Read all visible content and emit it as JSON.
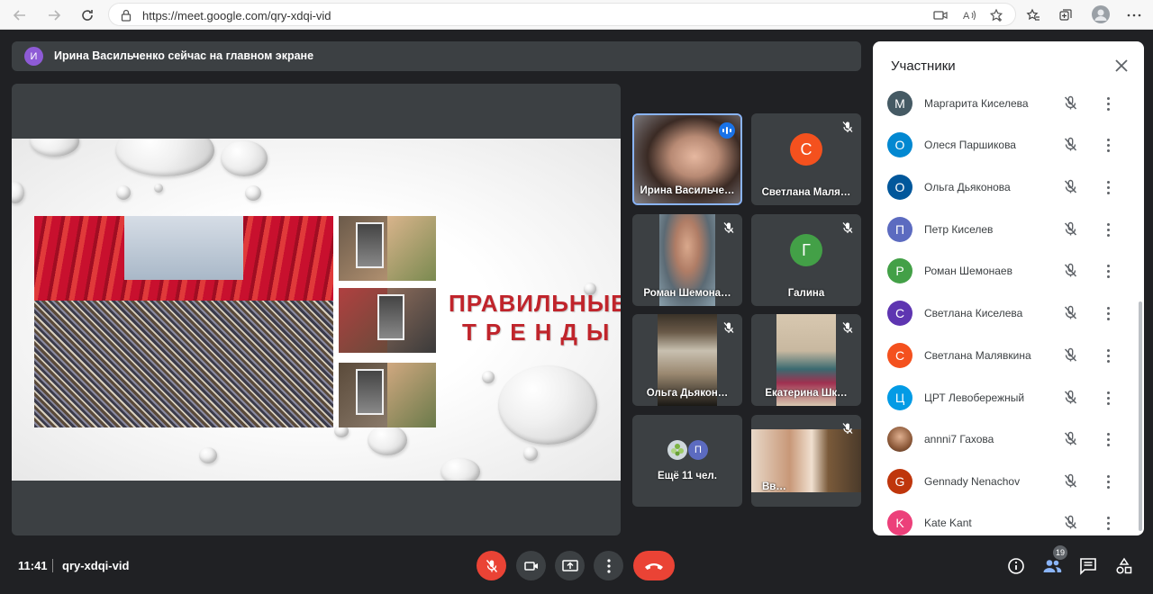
{
  "browser": {
    "url": "https://meet.google.com/qry-xdqi-vid"
  },
  "banner": {
    "avatar_letter": "И",
    "text": "Ирина Васильченко сейчас на главном экране"
  },
  "slide": {
    "title_line1": "ПРАВИЛЬНЫЕ",
    "title_line2": "ТРЕНДЫ"
  },
  "tiles": [
    {
      "name": "Ирина Васильче…",
      "type": "video",
      "speaking": true
    },
    {
      "name": "Светлана Маля…",
      "type": "avatar",
      "letter": "С",
      "color": "#f4511e"
    },
    {
      "name": "Роман Шемона…",
      "type": "video"
    },
    {
      "name": "Галина",
      "type": "avatar",
      "letter": "Г",
      "color": "#43a047"
    },
    {
      "name": "Ольга Дьякон…",
      "type": "video"
    },
    {
      "name": "Екатерина Шк…",
      "type": "video"
    },
    {
      "name": "Ещё 11 чел.",
      "type": "more",
      "letter": "П",
      "color": "#5c6bc0"
    },
    {
      "name": "Вв…",
      "type": "video"
    }
  ],
  "panel": {
    "title": "Участники",
    "participants": [
      {
        "letter": "М",
        "name": "Маргарита Киселева",
        "color": "#455a64"
      },
      {
        "letter": "О",
        "name": "Олеся Паршикова",
        "color": "#0288d1"
      },
      {
        "letter": "О",
        "name": "Ольга Дьяконова",
        "color": "#01579b"
      },
      {
        "letter": "П",
        "name": "Петр Киселев",
        "color": "#5c6bc0"
      },
      {
        "letter": "Р",
        "name": "Роман Шемонаев",
        "color": "#43a047"
      },
      {
        "letter": "С",
        "name": "Светлана Киселева",
        "color": "#5e35b1"
      },
      {
        "letter": "С",
        "name": "Светлана Малявкина",
        "color": "#f4511e"
      },
      {
        "letter": "Ц",
        "name": "ЦРТ Левобережный",
        "color": "#039be5"
      },
      {
        "letter": "",
        "name": "annni7 Гахова",
        "color": "#8d6e63"
      },
      {
        "letter": "G",
        "name": "Gennady Nenachov",
        "color": "#bf360c"
      },
      {
        "letter": "K",
        "name": "Kate Kant",
        "color": "#ec407a"
      }
    ]
  },
  "footer": {
    "time": "11:41",
    "meeting_code": "qry-xdqi-vid",
    "participants_count": "19"
  }
}
